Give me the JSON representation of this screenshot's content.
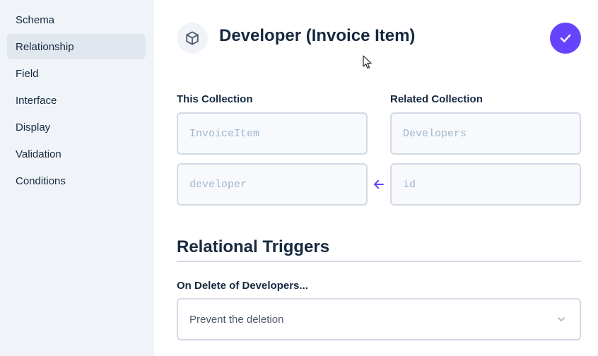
{
  "sidebar": {
    "items": [
      {
        "label": "Schema",
        "active": false
      },
      {
        "label": "Relationship",
        "active": true
      },
      {
        "label": "Field",
        "active": false
      },
      {
        "label": "Interface",
        "active": false
      },
      {
        "label": "Display",
        "active": false
      },
      {
        "label": "Validation",
        "active": false
      },
      {
        "label": "Conditions",
        "active": false
      }
    ]
  },
  "header": {
    "title": "Developer (Invoice Item)",
    "icon": "cube-icon",
    "save_icon": "check-icon"
  },
  "relationship": {
    "this_collection_label": "This Collection",
    "related_collection_label": "Related Collection",
    "this_collection_value": "InvoiceItem",
    "related_collection_value": "Developers",
    "this_field_value": "developer",
    "related_field_value": "id",
    "arrow_icon": "arrow-left-icon"
  },
  "triggers": {
    "title": "Relational Triggers",
    "on_delete_label": "On Delete of Developers...",
    "on_delete_value": "Prevent the deletion"
  },
  "colors": {
    "accent": "#6644ff",
    "sidebar_bg": "#f0f4f9",
    "active_item_bg": "#e1e7ef",
    "text": "#172940",
    "border": "#d3dae4"
  }
}
